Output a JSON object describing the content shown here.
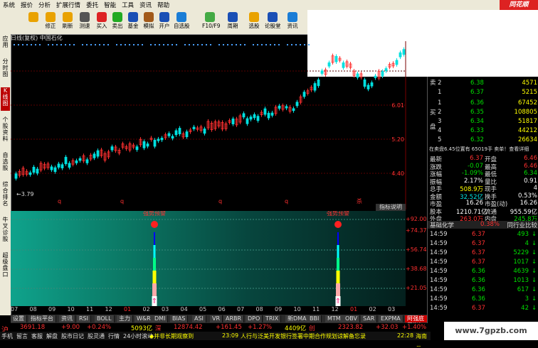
{
  "menu": [
    "系统",
    "报价",
    "分析",
    "扩展行情",
    "委托",
    "智能",
    "工具",
    "资讯",
    "帮助"
  ],
  "brand": "同花顺",
  "toolbar": [
    {
      "label": "",
      "icon": "back-arrow-icon",
      "color": "#e9a200"
    },
    {
      "label": "修正",
      "icon": "up-arrow-icon",
      "color": "#e9a200"
    },
    {
      "label": "刷新",
      "icon": "refresh-icon",
      "color": "#e9a200"
    },
    {
      "label": "测速",
      "icon": "clock-icon",
      "color": "#555"
    },
    {
      "label": "买入",
      "icon": "buy-icon",
      "color": "#d22"
    },
    {
      "label": "卖出",
      "icon": "sell-icon",
      "color": "#2a2"
    },
    {
      "label": "基金",
      "icon": "fund-icon",
      "color": "#1a4fb5"
    },
    {
      "label": "模拟",
      "icon": "hammer-icon",
      "color": "#a25a1a"
    },
    {
      "label": "开户",
      "icon": "account-icon",
      "color": "#1a4fb5"
    },
    {
      "label": "自选股",
      "icon": "grid-icon",
      "color": "#1a7dd6"
    },
    {
      "label": "F10/F9",
      "icon": "book-icon",
      "color": "#4a4"
    },
    {
      "label": "周期",
      "icon": "period-icon",
      "color": "#1a4fb5"
    },
    {
      "label": "选股",
      "icon": "filter-icon",
      "color": "#e9a200"
    },
    {
      "label": "论股堂",
      "icon": "forum-icon",
      "color": "#1a4fb5"
    },
    {
      "label": "资讯",
      "icon": "news-icon",
      "color": "#1a7dd6"
    }
  ],
  "left_tabs": [
    {
      "label": "应用",
      "active": false
    },
    {
      "label": "分时图",
      "active": false
    },
    {
      "label": "K线图",
      "active": true
    },
    {
      "label": "个股资料",
      "active": false
    },
    {
      "label": "自选股",
      "active": false
    },
    {
      "label": "综合排名",
      "active": false
    },
    {
      "label": "牛叉诊股",
      "active": false
    },
    {
      "label": "超级盘口",
      "active": false
    }
  ],
  "chart_title": "日线(复权) 中国石化",
  "chart_data": {
    "type": "candlestick",
    "price_ticks": [
      "6.01",
      "5.20",
      "4.40"
    ],
    "low_label": "3.79",
    "indicator_ticks": [
      "+92.00",
      "+74.37",
      "+56.74",
      "+38.68",
      "+21.05"
    ],
    "signal_labels": [
      "强势预警",
      "强势预警"
    ],
    "date_ticks": [
      "07",
      "08",
      "09",
      "10",
      "11",
      "12",
      "01",
      "02",
      "03",
      "04",
      "05",
      "06",
      "07",
      "08",
      "09",
      "10",
      "11",
      "12",
      "01",
      "02",
      "03"
    ]
  },
  "indicator_tab": "指标说明",
  "bottom_tabs": [
    {
      "label": "设置",
      "active": false
    },
    {
      "label": "指标平台",
      "active": false
    },
    {
      "label": "资讯",
      "active": false
    },
    {
      "label": "RSI",
      "active": false
    },
    {
      "label": "BOLL",
      "active": false
    },
    {
      "label": "主力",
      "active": false
    },
    {
      "label": "W&R",
      "active": false
    },
    {
      "label": "DMI",
      "active": false
    },
    {
      "label": "BIAS",
      "active": false
    },
    {
      "label": "ASI",
      "active": false
    },
    {
      "label": "VR",
      "active": false
    },
    {
      "label": "ARBR",
      "active": false
    },
    {
      "label": "DPO",
      "active": false
    },
    {
      "label": "TRIX",
      "active": false
    },
    {
      "label": "新DMA",
      "active": false
    },
    {
      "label": "BBI",
      "active": false
    },
    {
      "label": "MTM",
      "active": false
    },
    {
      "label": "OBV",
      "active": false
    },
    {
      "label": "SAR",
      "active": false
    },
    {
      "label": "EXPMA",
      "active": false
    },
    {
      "label": "阿强底买指标",
      "active": true
    }
  ],
  "ticker": {
    "sh_label": "沪",
    "sh_value": "3691.18",
    "sh_change": "+9.00",
    "sh_pct": "+0.24%",
    "sh_amount": "5093亿",
    "sz_label": "深",
    "sz_value": "12874.42",
    "sz_change": "+161.45",
    "sz_pct": "+1.27%",
    "sz_amount": "4409亿",
    "cy_label": "创",
    "cy_value": "2323.82",
    "cy_change": "+32.03",
    "cy_pct": "+1.40%"
  },
  "status": {
    "items": [
      "手机",
      "留言",
      "客服",
      "解盘",
      "股市日记",
      "股灵通",
      "行情",
      "24小时滚动"
    ],
    "news1": "◆并非长期观察到",
    "time1": "23:09",
    "news2": "人行与泛美开发银行签署中期合作规划谅解备忘录",
    "time2": "22:28",
    "news3": "海南省"
  },
  "orderbook": {
    "sell_label": "卖盘",
    "buy_label": "买盘",
    "sells": [
      {
        "lvl": "2",
        "price": "6.38",
        "vol": "4571"
      },
      {
        "lvl": "1",
        "price": "6.37",
        "vol": "5215"
      }
    ],
    "buys": [
      {
        "lvl": "1",
        "price": "6.36",
        "vol": "67452"
      },
      {
        "lvl": "2",
        "price": "6.35",
        "vol": "108805"
      },
      {
        "lvl": "3",
        "price": "6.34",
        "vol": "51817"
      },
      {
        "lvl": "4",
        "price": "6.33",
        "vol": "44212"
      },
      {
        "lvl": "5",
        "price": "6.32",
        "vol": "26634"
      }
    ],
    "note": "在卖盘6.45位置有 65019手 卖单！查看详细"
  },
  "quote": [
    {
      "l": "最新",
      "v": "6.37",
      "c": "red",
      "l2": "开盘",
      "v2": "6.46",
      "c2": "red"
    },
    {
      "l": "涨跌",
      "v": "-0.07",
      "c": "grn",
      "l2": "最高",
      "v2": "6.46",
      "c2": "red"
    },
    {
      "l": "涨幅",
      "v": "-1.09%",
      "c": "grn",
      "l2": "最低",
      "v2": "6.34",
      "c2": "grn"
    },
    {
      "l": "振幅",
      "v": "2.17%",
      "c": "wht",
      "l2": "量比",
      "v2": "0.91",
      "c2": "wht"
    },
    {
      "l": "总手",
      "v": "508.9万",
      "c": "yel",
      "l2": "现手",
      "v2": "4",
      "c2": "wht"
    },
    {
      "l": "金额",
      "v": "32.52亿",
      "c": "cyan",
      "l2": "换手",
      "v2": "0.53%",
      "c2": "wht"
    },
    {
      "l": "市盈",
      "v": "16.26",
      "c": "wht",
      "l2": "市盈(动)",
      "v2": "16.26",
      "c2": "wht"
    },
    {
      "l": "股本",
      "v": "1210.71亿",
      "c": "wht",
      "l2": "流通",
      "v2": "955.59亿",
      "c2": "wht"
    },
    {
      "l": "外盘",
      "v": "263.0万",
      "c": "red",
      "l2": "内盘",
      "v2": "245.8万",
      "c2": "grn"
    }
  ],
  "sector": {
    "name": "基础化学",
    "pct": "0.38%",
    "compare": "同行业比较"
  },
  "ticks": [
    {
      "t": "14:59",
      "p": "6.37",
      "v": "493",
      "d": "down"
    },
    {
      "t": "14:59",
      "p": "6.37",
      "v": "4",
      "d": "down"
    },
    {
      "t": "14:59",
      "p": "6.37",
      "v": "5229",
      "d": "down"
    },
    {
      "t": "14:59",
      "p": "6.37",
      "v": "1017",
      "d": "down"
    },
    {
      "t": "14:59",
      "p": "6.36",
      "v": "4639",
      "d": "down"
    },
    {
      "t": "14:59",
      "p": "6.36",
      "v": "1013",
      "d": "down"
    },
    {
      "t": "14:59",
      "p": "6.36",
      "v": "617",
      "d": "down"
    },
    {
      "t": "14:59",
      "p": "6.36",
      "v": "3",
      "d": "down"
    },
    {
      "t": "14:59",
      "p": "6.37",
      "v": "42",
      "d": "down"
    }
  ],
  "watermark": "www.7gpzb.com"
}
